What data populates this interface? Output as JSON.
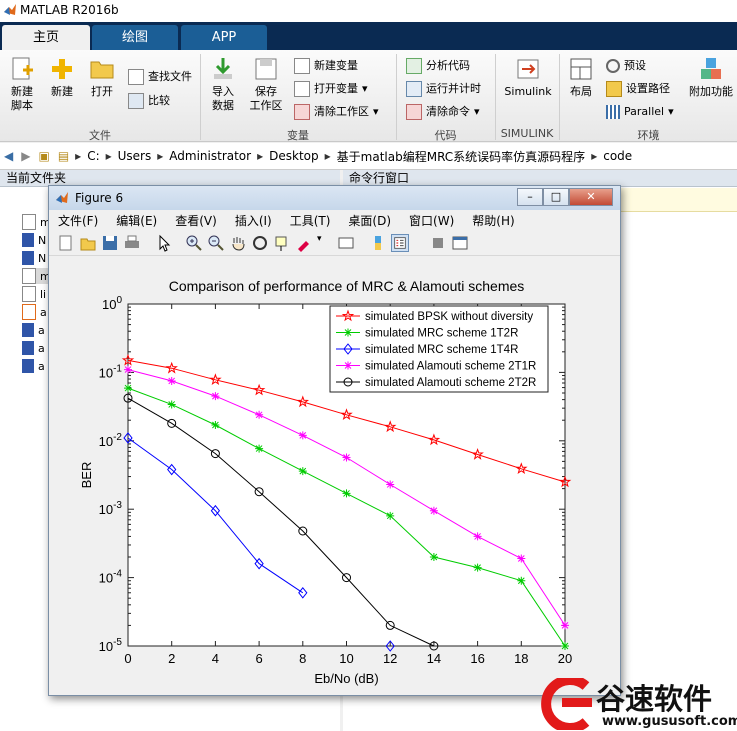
{
  "app": {
    "title": "MATLAB R2016b"
  },
  "tabs": [
    "主页",
    "绘图",
    "APP"
  ],
  "ribbon": {
    "new_script": "新建\n脚本",
    "new": "新建",
    "open": "打开",
    "find_files": "查找文件",
    "compare": "比较",
    "file_group": "文件",
    "import": "导入\n数据",
    "save_ws": "保存\n工作区",
    "new_var": "新建变量",
    "open_var": "打开变量",
    "clear_ws": "清除工作区",
    "var_group": "变量",
    "analyze": "分析代码",
    "run_time": "运行并计时",
    "clear_cmd": "清除命令",
    "code_group": "代码",
    "simulink": "Simulink",
    "simulink_group": "SIMULINK",
    "layout": "布局",
    "prefs": "预设",
    "set_path": "设置路径",
    "parallel": "Parallel",
    "env_group": "环境",
    "addons": "附加功能"
  },
  "address": [
    "C:",
    "Users",
    "Administrator",
    "Desktop",
    "基于matlab编程MRC系统误码率仿真源码程序",
    "code"
  ],
  "panels": {
    "current_folder": "当前文件夹",
    "command_window": "命令行窗口"
  },
  "files": [
    "m",
    "N",
    "N",
    "m",
    "li",
    "a",
    "a",
    "a",
    "a"
  ],
  "figure": {
    "title": "Figure 6",
    "menus": [
      "文件(F)",
      "编辑(E)",
      "查看(V)",
      "插入(I)",
      "工具(T)",
      "桌面(D)",
      "窗口(W)",
      "帮助(H)"
    ]
  },
  "watermark": {
    "brand": "谷速软件",
    "url": "www.gususoft.com"
  },
  "chart_data": {
    "type": "line",
    "title": "Comparison of performance of MRC & Alamouti schemes",
    "xlabel": "Eb/No (dB)",
    "ylabel": "BER",
    "xlim": [
      0,
      20
    ],
    "ylim": [
      1e-05,
      1
    ],
    "yscale": "log",
    "xticks": [
      0,
      2,
      4,
      6,
      8,
      10,
      12,
      14,
      16,
      18,
      20
    ],
    "legend_position": "top-right",
    "series": [
      {
        "name": "simulated BPSK without diversity",
        "color": "#ff0000",
        "marker": "pentagram",
        "x": [
          0,
          2,
          4,
          6,
          8,
          10,
          12,
          14,
          16,
          18,
          20
        ],
        "y": [
          0.15,
          0.115,
          0.078,
          0.055,
          0.037,
          0.024,
          0.016,
          0.0103,
          0.0063,
          0.0039,
          0.0025
        ]
      },
      {
        "name": "simulated MRC scheme 1T2R",
        "color": "#00cc00",
        "marker": "star",
        "x": [
          0,
          2,
          4,
          6,
          8,
          10,
          12,
          14,
          16,
          18,
          20
        ],
        "y": [
          0.059,
          0.034,
          0.017,
          0.0077,
          0.0036,
          0.0017,
          0.0008,
          0.0002,
          0.00014,
          9e-05,
          1e-05
        ]
      },
      {
        "name": "simulated MRC scheme 1T4R",
        "color": "#0000ff",
        "marker": "diamond",
        "x": [
          0,
          2,
          4,
          6,
          8,
          null,
          12
        ],
        "y": [
          0.011,
          0.0038,
          0.00095,
          0.00016,
          6e-05,
          null,
          1e-05
        ]
      },
      {
        "name": "simulated Alamouti scheme 2T1R",
        "color": "#ff00ff",
        "marker": "star",
        "x": [
          0,
          2,
          4,
          6,
          8,
          10,
          12,
          14,
          16,
          18,
          20
        ],
        "y": [
          0.11,
          0.075,
          0.045,
          0.024,
          0.012,
          0.0057,
          0.0023,
          0.00095,
          0.0004,
          0.00019,
          2e-05
        ]
      },
      {
        "name": "simulated Alamouti scheme 2T2R",
        "color": "#000000",
        "marker": "circle",
        "x": [
          0,
          2,
          4,
          6,
          8,
          10,
          12,
          14
        ],
        "y": [
          0.042,
          0.018,
          0.0065,
          0.0018,
          0.00048,
          0.0001,
          2e-05,
          1e-05
        ]
      }
    ]
  }
}
